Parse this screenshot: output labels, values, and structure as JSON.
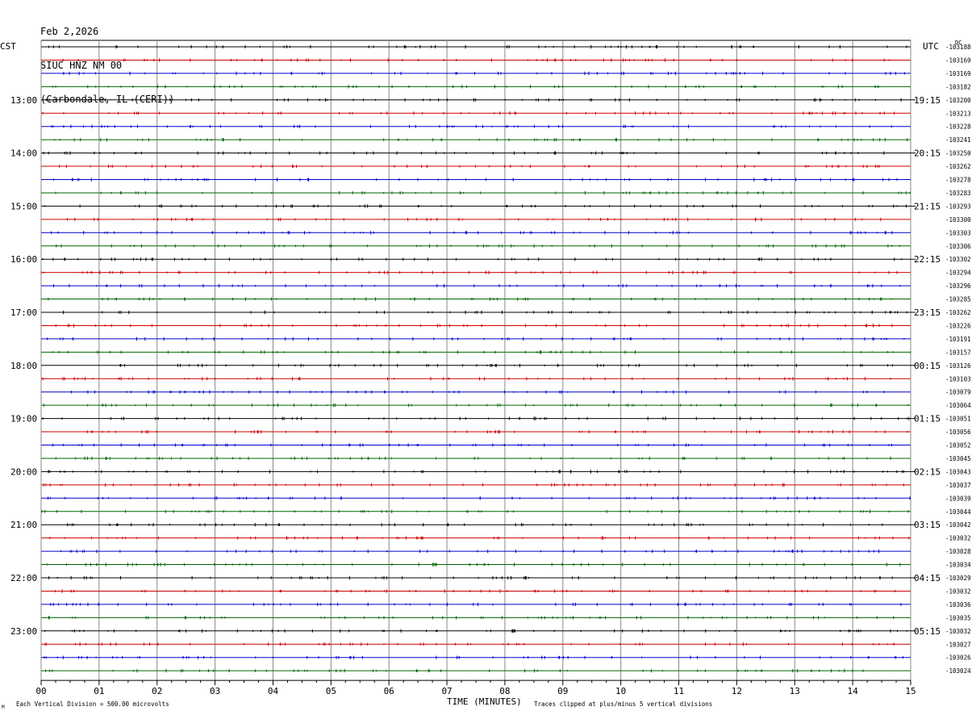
{
  "chart_data": {
    "type": "line",
    "title_lines": [
      "Feb 2,2026",
      "SIUC HNZ NM 00",
      "(Carbondale, IL (CERI))"
    ],
    "left_axis_label": "CST",
    "right_axis_label": "UTC",
    "dc_label": "DC",
    "xlabel": "TIME (MINUTES)",
    "xlim": [
      0,
      15
    ],
    "x_ticks": [
      "00",
      "01",
      "02",
      "03",
      "04",
      "05",
      "06",
      "07",
      "08",
      "09",
      "10",
      "11",
      "12",
      "13",
      "14",
      "15"
    ],
    "left_hour_labels": [
      "13:00",
      "14:00",
      "15:00",
      "16:00",
      "17:00",
      "18:00",
      "19:00",
      "20:00",
      "21:00",
      "22:00",
      "23:00"
    ],
    "right_hour_labels": [
      "19:15",
      "20:15",
      "21:15",
      "22:15",
      "23:15",
      "00:15",
      "01:15",
      "02:15",
      "03:15",
      "04:15",
      "05:15"
    ],
    "dc_offsets": [
      "-103188",
      "-103169",
      "-103169",
      "-103182",
      "-103200",
      "-103213",
      "-103228",
      "-103241",
      "-103250",
      "-103262",
      "-103278",
      "-103283",
      "-103293",
      "-103300",
      "-103303",
      "-103306",
      "-103302",
      "-103294",
      "-103296",
      "-103285",
      "-103262",
      "-103226",
      "-103191",
      "-103157",
      "-103126",
      "-103103",
      "-103079",
      "-103064",
      "-103051",
      "-103056",
      "-103052",
      "-103045",
      "-103043",
      "-103037",
      "-103039",
      "-103044",
      "-103042",
      "-103032",
      "-103028",
      "-103034",
      "-103029",
      "-103032",
      "-103036",
      "-103035",
      "-103032",
      "-103027",
      "-103026",
      "-103024"
    ],
    "trace_colors": [
      "#000000",
      "#cc0000",
      "#0000cc",
      "#006600"
    ],
    "footer_left": "Each Vertical Division =  500.00 microvolts",
    "footer_right": "Traces clipped at plus/minus 5 vertical divisions",
    "corner_mark": "M"
  }
}
